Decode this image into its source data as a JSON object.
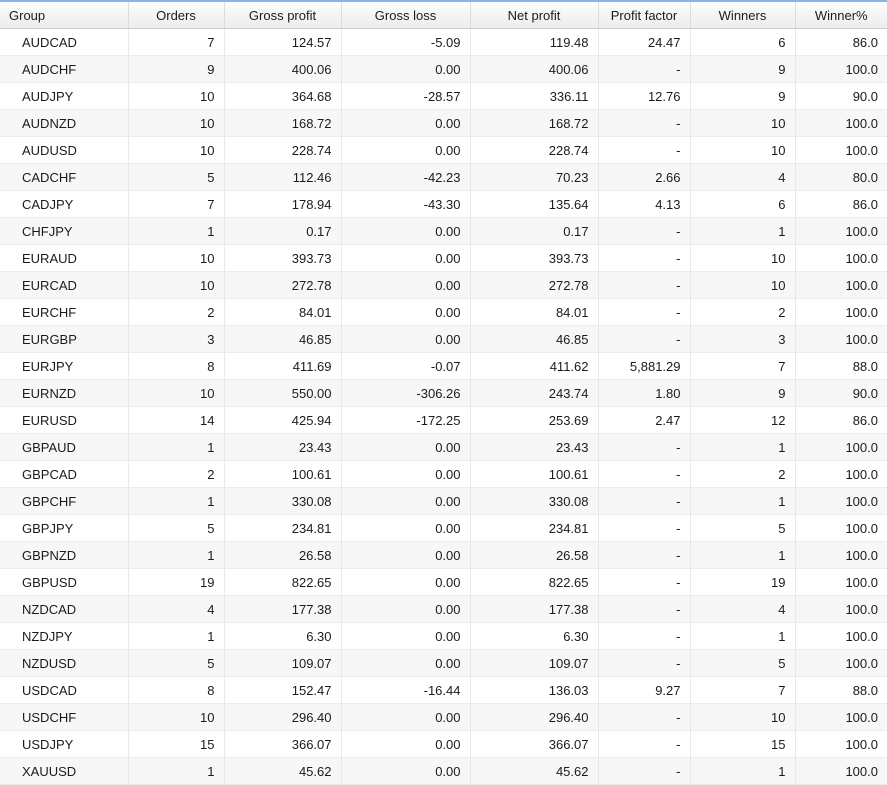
{
  "table": {
    "columns": [
      {
        "key": "group",
        "label": "Group",
        "align": "left"
      },
      {
        "key": "orders",
        "label": "Orders",
        "align": "right"
      },
      {
        "key": "gross_profit",
        "label": "Gross profit",
        "align": "right"
      },
      {
        "key": "gross_loss",
        "label": "Gross loss",
        "align": "right"
      },
      {
        "key": "net_profit",
        "label": "Net profit",
        "align": "right"
      },
      {
        "key": "profit_factor",
        "label": "Profit factor",
        "align": "right"
      },
      {
        "key": "winners",
        "label": "Winners",
        "align": "right"
      },
      {
        "key": "winner_pct",
        "label": "Winner%",
        "align": "right"
      }
    ],
    "rows": [
      {
        "group": "AUDCAD",
        "orders": "7",
        "gross_profit": "124.57",
        "gross_loss": "-5.09",
        "net_profit": "119.48",
        "profit_factor": "24.47",
        "winners": "6",
        "winner_pct": "86.0"
      },
      {
        "group": "AUDCHF",
        "orders": "9",
        "gross_profit": "400.06",
        "gross_loss": "0.00",
        "net_profit": "400.06",
        "profit_factor": "-",
        "winners": "9",
        "winner_pct": "100.0"
      },
      {
        "group": "AUDJPY",
        "orders": "10",
        "gross_profit": "364.68",
        "gross_loss": "-28.57",
        "net_profit": "336.11",
        "profit_factor": "12.76",
        "winners": "9",
        "winner_pct": "90.0"
      },
      {
        "group": "AUDNZD",
        "orders": "10",
        "gross_profit": "168.72",
        "gross_loss": "0.00",
        "net_profit": "168.72",
        "profit_factor": "-",
        "winners": "10",
        "winner_pct": "100.0"
      },
      {
        "group": "AUDUSD",
        "orders": "10",
        "gross_profit": "228.74",
        "gross_loss": "0.00",
        "net_profit": "228.74",
        "profit_factor": "-",
        "winners": "10",
        "winner_pct": "100.0"
      },
      {
        "group": "CADCHF",
        "orders": "5",
        "gross_profit": "112.46",
        "gross_loss": "-42.23",
        "net_profit": "70.23",
        "profit_factor": "2.66",
        "winners": "4",
        "winner_pct": "80.0"
      },
      {
        "group": "CADJPY",
        "orders": "7",
        "gross_profit": "178.94",
        "gross_loss": "-43.30",
        "net_profit": "135.64",
        "profit_factor": "4.13",
        "winners": "6",
        "winner_pct": "86.0"
      },
      {
        "group": "CHFJPY",
        "orders": "1",
        "gross_profit": "0.17",
        "gross_loss": "0.00",
        "net_profit": "0.17",
        "profit_factor": "-",
        "winners": "1",
        "winner_pct": "100.0"
      },
      {
        "group": "EURAUD",
        "orders": "10",
        "gross_profit": "393.73",
        "gross_loss": "0.00",
        "net_profit": "393.73",
        "profit_factor": "-",
        "winners": "10",
        "winner_pct": "100.0"
      },
      {
        "group": "EURCAD",
        "orders": "10",
        "gross_profit": "272.78",
        "gross_loss": "0.00",
        "net_profit": "272.78",
        "profit_factor": "-",
        "winners": "10",
        "winner_pct": "100.0"
      },
      {
        "group": "EURCHF",
        "orders": "2",
        "gross_profit": "84.01",
        "gross_loss": "0.00",
        "net_profit": "84.01",
        "profit_factor": "-",
        "winners": "2",
        "winner_pct": "100.0"
      },
      {
        "group": "EURGBP",
        "orders": "3",
        "gross_profit": "46.85",
        "gross_loss": "0.00",
        "net_profit": "46.85",
        "profit_factor": "-",
        "winners": "3",
        "winner_pct": "100.0"
      },
      {
        "group": "EURJPY",
        "orders": "8",
        "gross_profit": "411.69",
        "gross_loss": "-0.07",
        "net_profit": "411.62",
        "profit_factor": "5,881.29",
        "winners": "7",
        "winner_pct": "88.0"
      },
      {
        "group": "EURNZD",
        "orders": "10",
        "gross_profit": "550.00",
        "gross_loss": "-306.26",
        "net_profit": "243.74",
        "profit_factor": "1.80",
        "winners": "9",
        "winner_pct": "90.0"
      },
      {
        "group": "EURUSD",
        "orders": "14",
        "gross_profit": "425.94",
        "gross_loss": "-172.25",
        "net_profit": "253.69",
        "profit_factor": "2.47",
        "winners": "12",
        "winner_pct": "86.0"
      },
      {
        "group": "GBPAUD",
        "orders": "1",
        "gross_profit": "23.43",
        "gross_loss": "0.00",
        "net_profit": "23.43",
        "profit_factor": "-",
        "winners": "1",
        "winner_pct": "100.0"
      },
      {
        "group": "GBPCAD",
        "orders": "2",
        "gross_profit": "100.61",
        "gross_loss": "0.00",
        "net_profit": "100.61",
        "profit_factor": "-",
        "winners": "2",
        "winner_pct": "100.0"
      },
      {
        "group": "GBPCHF",
        "orders": "1",
        "gross_profit": "330.08",
        "gross_loss": "0.00",
        "net_profit": "330.08",
        "profit_factor": "-",
        "winners": "1",
        "winner_pct": "100.0"
      },
      {
        "group": "GBPJPY",
        "orders": "5",
        "gross_profit": "234.81",
        "gross_loss": "0.00",
        "net_profit": "234.81",
        "profit_factor": "-",
        "winners": "5",
        "winner_pct": "100.0"
      },
      {
        "group": "GBPNZD",
        "orders": "1",
        "gross_profit": "26.58",
        "gross_loss": "0.00",
        "net_profit": "26.58",
        "profit_factor": "-",
        "winners": "1",
        "winner_pct": "100.0"
      },
      {
        "group": "GBPUSD",
        "orders": "19",
        "gross_profit": "822.65",
        "gross_loss": "0.00",
        "net_profit": "822.65",
        "profit_factor": "-",
        "winners": "19",
        "winner_pct": "100.0"
      },
      {
        "group": "NZDCAD",
        "orders": "4",
        "gross_profit": "177.38",
        "gross_loss": "0.00",
        "net_profit": "177.38",
        "profit_factor": "-",
        "winners": "4",
        "winner_pct": "100.0"
      },
      {
        "group": "NZDJPY",
        "orders": "1",
        "gross_profit": "6.30",
        "gross_loss": "0.00",
        "net_profit": "6.30",
        "profit_factor": "-",
        "winners": "1",
        "winner_pct": "100.0"
      },
      {
        "group": "NZDUSD",
        "orders": "5",
        "gross_profit": "109.07",
        "gross_loss": "0.00",
        "net_profit": "109.07",
        "profit_factor": "-",
        "winners": "5",
        "winner_pct": "100.0"
      },
      {
        "group": "USDCAD",
        "orders": "8",
        "gross_profit": "152.47",
        "gross_loss": "-16.44",
        "net_profit": "136.03",
        "profit_factor": "9.27",
        "winners": "7",
        "winner_pct": "88.0"
      },
      {
        "group": "USDCHF",
        "orders": "10",
        "gross_profit": "296.40",
        "gross_loss": "0.00",
        "net_profit": "296.40",
        "profit_factor": "-",
        "winners": "10",
        "winner_pct": "100.0"
      },
      {
        "group": "USDJPY",
        "orders": "15",
        "gross_profit": "366.07",
        "gross_loss": "0.00",
        "net_profit": "366.07",
        "profit_factor": "-",
        "winners": "15",
        "winner_pct": "100.0"
      },
      {
        "group": "XAUUSD",
        "orders": "1",
        "gross_profit": "45.62",
        "gross_loss": "0.00",
        "net_profit": "45.62",
        "profit_factor": "-",
        "winners": "1",
        "winner_pct": "100.0"
      }
    ]
  },
  "colors": {
    "top_accent": "#8ab4e8",
    "header_bg": "#f4f4f4",
    "row_alt_bg": "#f7f7f7",
    "text": "#1b1b1b",
    "grid_line": "#e8e8e8"
  }
}
